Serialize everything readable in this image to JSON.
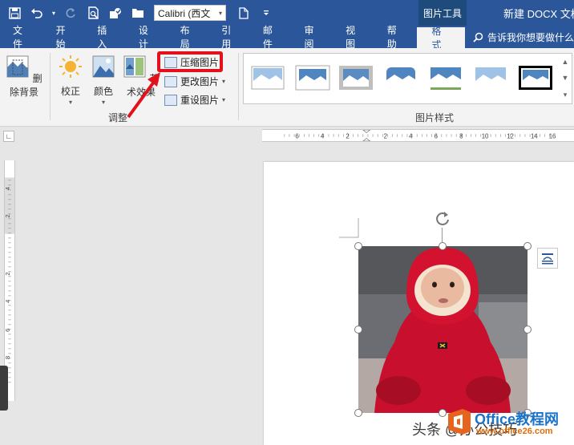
{
  "quick_access": {
    "font_name": "Calibri (西文"
  },
  "context_tab_title": "图片工具",
  "document_title": "新建 DOCX 文档",
  "tabs": [
    {
      "label": "文件"
    },
    {
      "label": "开始"
    },
    {
      "label": "插入"
    },
    {
      "label": "设计"
    },
    {
      "label": "布局"
    },
    {
      "label": "引用"
    },
    {
      "label": "邮件"
    },
    {
      "label": "审阅"
    },
    {
      "label": "视图"
    },
    {
      "label": "帮助"
    },
    {
      "label": "格式"
    }
  ],
  "tell_me": "告诉我你想要做什么",
  "ribbon": {
    "remove_bg": "删除背景",
    "corrections": "校正",
    "color": "颜色",
    "artistic": "艺术效果",
    "compress": "压缩图片",
    "change_picture": "更改图片",
    "reset_picture": "重设图片",
    "adjust_group": "调整",
    "styles_group": "图片样式"
  },
  "ruler": {
    "h_ticks": [
      "6",
      "4",
      "2",
      "2",
      "4",
      "6",
      "8",
      "10",
      "12",
      "14",
      "16"
    ],
    "v_ticks": [
      "4",
      "2",
      "2",
      "4",
      "6",
      "8"
    ]
  },
  "watermark": {
    "text": "头条 @办公技巧",
    "logo_title": "Office教程网",
    "logo_url": "www.office26.com"
  },
  "colors": {
    "brand": "#2b579a",
    "highlight": "#e3111b"
  }
}
